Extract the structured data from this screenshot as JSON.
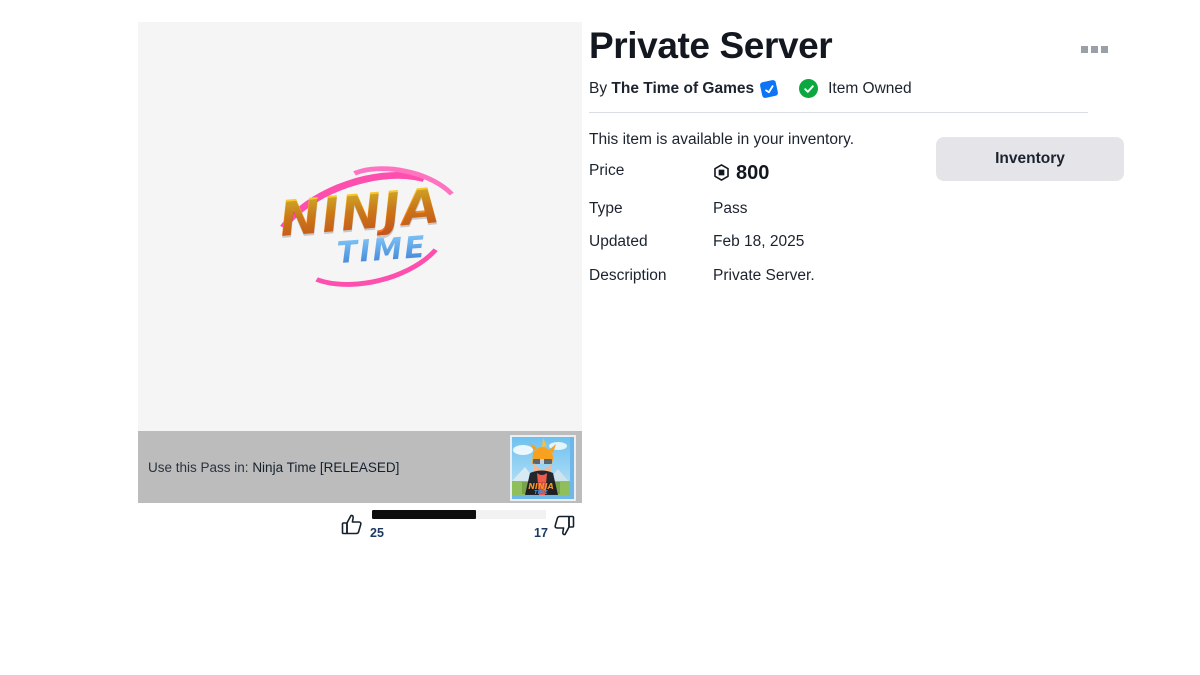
{
  "item": {
    "title": "Private Server",
    "creator_prefix": "By",
    "creator_name": "The Time of Games",
    "verified_badge_icon": "verified-badge-icon",
    "owned_check_icon": "check-circle-icon",
    "ownership_label": "Item Owned",
    "overflow_menu_icon": "three-dots-icon",
    "availability_note": "This item is available in your inventory.",
    "inventory_button_label": "Inventory",
    "specs": [
      {
        "label": "Price",
        "value": "800",
        "currency_icon": "robux-icon",
        "is_price": true
      },
      {
        "label": "Type",
        "value": "Pass",
        "is_price": false
      },
      {
        "label": "Updated",
        "value": "Feb 18, 2025",
        "is_price": false
      },
      {
        "label": "Description",
        "value": "Private Server.",
        "is_price": false,
        "muted": true
      }
    ]
  },
  "media": {
    "art_icon": "ninja-time-logo",
    "logo_word_top": "NINJA",
    "logo_word_bottom": "TIME"
  },
  "pass_usage": {
    "label": "Use this Pass in:",
    "game_name": "Ninja Time [RELEASED]",
    "thumbnail_icon": "game-thumbnail-ninja-time"
  },
  "votes": {
    "upvote_icon": "thumbs-up-icon",
    "downvote_icon": "thumbs-down-icon",
    "upvote_count": "25",
    "downvote_count": "17",
    "fill_percent": "59.5%"
  },
  "colors": {
    "robux_dark": "#13171f",
    "verified_blue": "#0d73f7",
    "owned_green": "#0aa83f",
    "vote_fill": "#0e0e0e",
    "media_background": "#f5f5f6",
    "usage_bar_background": "#bcbcbc",
    "button_background": "#e4e4e9",
    "muted_text": "#8b8f98"
  }
}
